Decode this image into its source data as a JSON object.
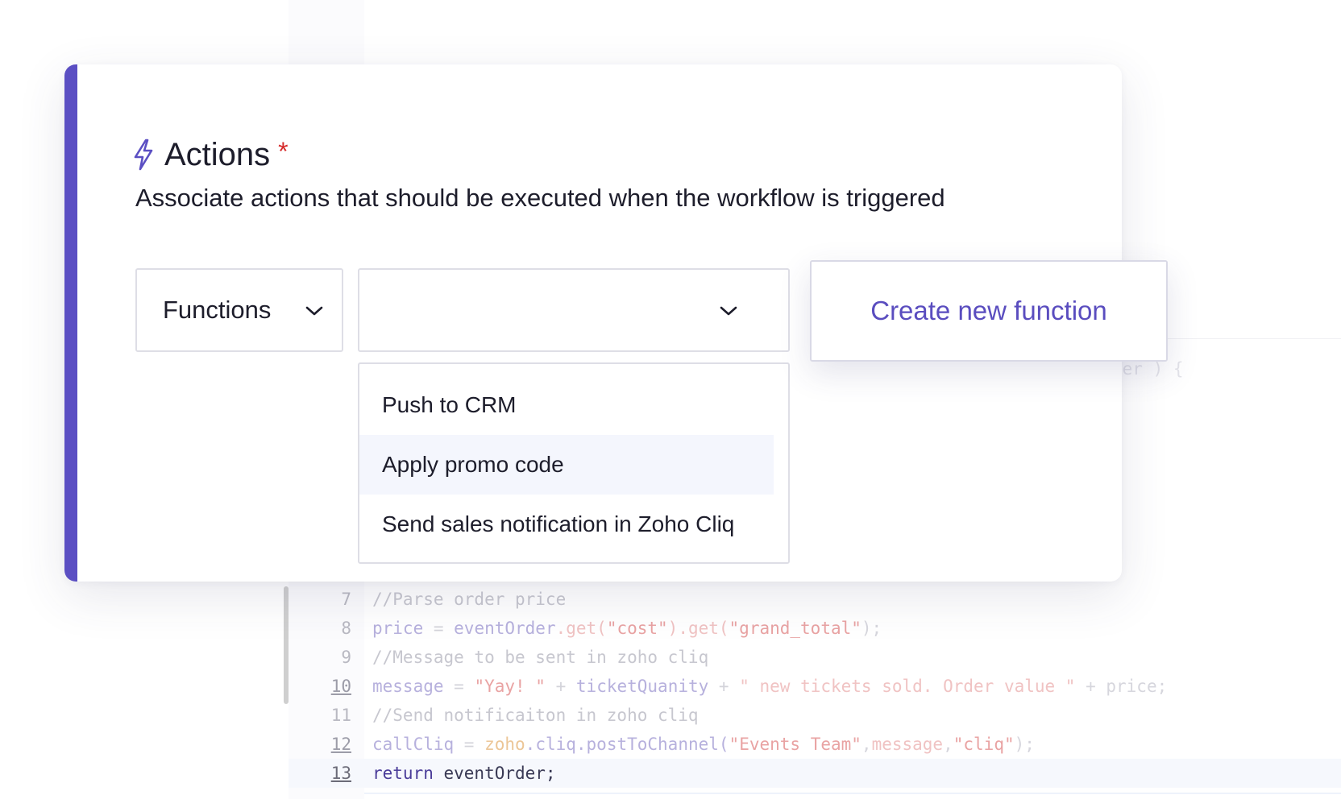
{
  "editor": {
    "ghost_text": "der ) {",
    "lines": [
      {
        "number": "7",
        "underlined": false,
        "active": false,
        "tokens": [
          {
            "t": "//Parse order price",
            "c": "t-c"
          }
        ]
      },
      {
        "number": "8",
        "underlined": false,
        "active": false,
        "tokens": [
          {
            "t": "price",
            "c": "t-v"
          },
          {
            "t": " = ",
            "c": "t-op"
          },
          {
            "t": "eventOrder",
            "c": "t-v"
          },
          {
            "t": ".get(",
            "c": "t-s2"
          },
          {
            "t": "\"cost\"",
            "c": "t-s"
          },
          {
            "t": ").get(",
            "c": "t-s2"
          },
          {
            "t": "\"grand_total\"",
            "c": "t-s"
          },
          {
            "t": ");",
            "c": "t-d"
          }
        ]
      },
      {
        "number": "9",
        "underlined": false,
        "active": false,
        "tokens": [
          {
            "t": "//Message to be sent in zoho cliq",
            "c": "t-c"
          }
        ]
      },
      {
        "number": "10",
        "underlined": true,
        "active": false,
        "tokens": [
          {
            "t": "message",
            "c": "t-v"
          },
          {
            "t": " = ",
            "c": "t-op"
          },
          {
            "t": "\"Yay! \"",
            "c": "t-s"
          },
          {
            "t": " + ",
            "c": "t-op"
          },
          {
            "t": "ticketQuanity",
            "c": "t-v"
          },
          {
            "t": " + ",
            "c": "t-op"
          },
          {
            "t": "\" new tickets sold. Order value \"",
            "c": "t-s2"
          },
          {
            "t": " + price;",
            "c": "t-d"
          }
        ]
      },
      {
        "number": "11",
        "underlined": false,
        "active": false,
        "tokens": [
          {
            "t": "//Send notificaiton in zoho cliq",
            "c": "t-c"
          }
        ]
      },
      {
        "number": "12",
        "underlined": true,
        "active": false,
        "tokens": [
          {
            "t": "callCliq",
            "c": "t-v"
          },
          {
            "t": " = ",
            "c": "t-op"
          },
          {
            "t": "zoho",
            "c": "t-z"
          },
          {
            "t": ".cliq.postToChannel(",
            "c": "t-f"
          },
          {
            "t": "\"Events Team\"",
            "c": "t-s"
          },
          {
            "t": ",",
            "c": "t-d"
          },
          {
            "t": "message",
            "c": "t-s2"
          },
          {
            "t": ",",
            "c": "t-d"
          },
          {
            "t": "\"cliq\"",
            "c": "t-s"
          },
          {
            "t": ");",
            "c": "t-d"
          }
        ]
      },
      {
        "number": "13",
        "underlined": true,
        "active": true,
        "tokens": [
          {
            "t": "return",
            "c": "t-k"
          },
          {
            "t": " eventOrder;",
            "c": "t-k2"
          }
        ]
      }
    ]
  },
  "card": {
    "accent_color": "#5b4fc3",
    "icon": "lightning-bolt-icon",
    "title": "Actions",
    "required_marker": "*",
    "subtitle": "Associate actions that should be executed when the workflow is triggered",
    "action_type_select": {
      "value": "Functions"
    },
    "function_select": {
      "value": ""
    },
    "dropdown": {
      "highlighted_index": 1,
      "options": [
        "Push to CRM",
        "Apply promo code",
        "Send sales notification in Zoho Cliq"
      ]
    },
    "create_button_label": "Create new function"
  }
}
